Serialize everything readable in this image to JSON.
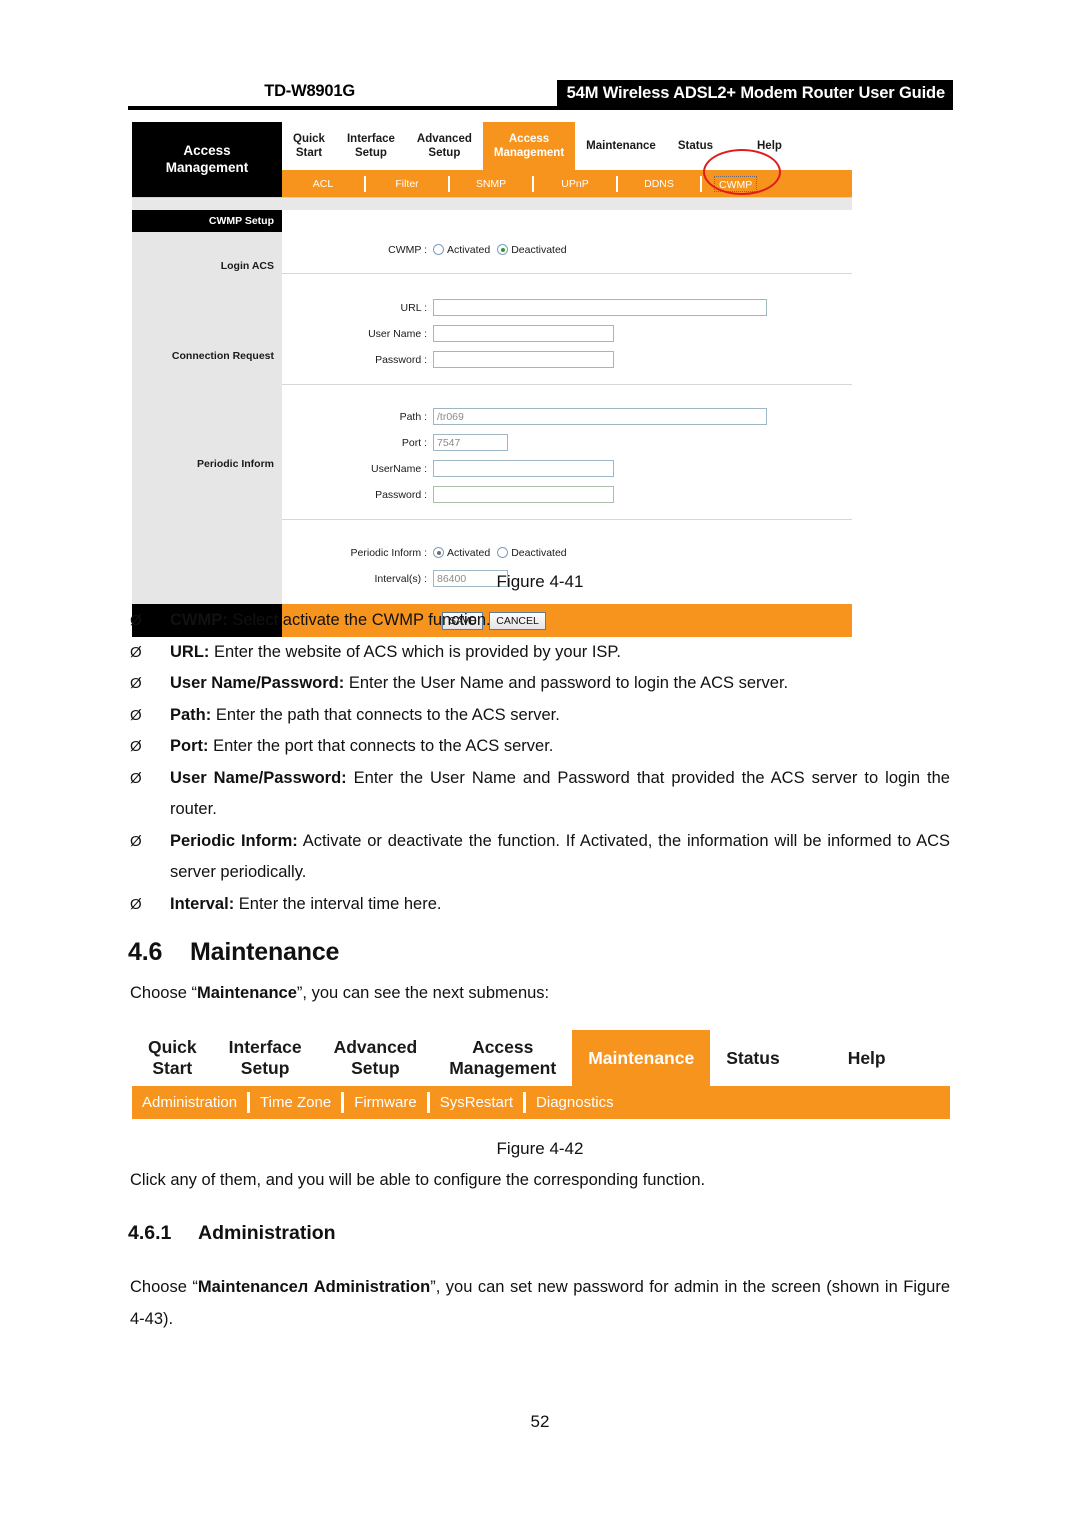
{
  "header": {
    "model": "TD-W8901G",
    "title": "54M Wireless ADSL2+ Modem Router User Guide"
  },
  "figure41": {
    "brand_line1": "Access",
    "brand_line2": "Management",
    "main_nav": [
      {
        "line1": "Quick",
        "line2": "Start",
        "active": false
      },
      {
        "line1": "Interface",
        "line2": "Setup",
        "active": false
      },
      {
        "line1": "Advanced",
        "line2": "Setup",
        "active": false
      },
      {
        "line1": "Access",
        "line2": "Management",
        "active": true
      },
      {
        "line1": "Maintenance",
        "line2": "",
        "active": false
      },
      {
        "line1": "Status",
        "line2": "",
        "active": false
      },
      {
        "line1": "Help",
        "line2": "",
        "active": false
      }
    ],
    "sub_nav": [
      "ACL",
      "Filter",
      "SNMP",
      "UPnP",
      "DDNS"
    ],
    "sub_nav_focused": "CWMP",
    "sidebar": {
      "title": "CWMP Setup",
      "login_acs": "Login ACS",
      "connection_request": "Connection Request",
      "periodic_inform": "Periodic Inform"
    },
    "fields": {
      "cwmp_label": "CWMP :",
      "cwmp_activated": "Activated",
      "cwmp_deactivated": "Deactivated",
      "cwmp_selected": "Deactivated",
      "url_label": "URL :",
      "url_value": "",
      "username_label": "User Name :",
      "username_value": "",
      "password_label": "Password :",
      "password_value": "",
      "path_label": "Path :",
      "path_value": "/tr069",
      "port_label": "Port :",
      "port_value": "7547",
      "cr_username_label": "UserName :",
      "cr_username_value": "",
      "cr_password_label": "Password :",
      "cr_password_value": "",
      "pi_label": "Periodic Inform :",
      "pi_activated": "Activated",
      "pi_deactivated": "Deactivated",
      "pi_selected": "Activated",
      "interval_label": "Interval(s) :",
      "interval_value": "86400"
    },
    "buttons": {
      "save": "SAVE",
      "cancel": "CANCEL"
    },
    "caption": "Figure 4-41"
  },
  "bullets41": [
    {
      "mark": "Ø",
      "term": "CWMP:",
      "text": " Select activate the CWMP function."
    },
    {
      "mark": "Ø",
      "term": "URL:",
      "text": " Enter the website of ACS which is provided by your ISP."
    },
    {
      "mark": "Ø",
      "term": "User Name/Password:",
      "text": " Enter the User Name and password to login the ACS server."
    },
    {
      "mark": "Ø",
      "term": "Path:",
      "text": " Enter the path that connects to the ACS server."
    },
    {
      "mark": "Ø",
      "term": "Port:",
      "text": " Enter the port that connects to the ACS server."
    },
    {
      "mark": "Ø",
      "term": "User Name/Password:",
      "text": " Enter the User Name and Password that provided the ACS server to login the router."
    },
    {
      "mark": "Ø",
      "term": "Periodic Inform:",
      "text": " Activate or deactivate the function. If Activated, the information will be informed to ACS server periodically."
    },
    {
      "mark": "Ø",
      "term": "Interval:",
      "text": " Enter the interval time here."
    }
  ],
  "section": {
    "number": "4.6",
    "title": "Maintenance",
    "intro_pre": "Choose “",
    "intro_bold": "Maintenance",
    "intro_post": "”, you can see the next submenus:"
  },
  "figure42": {
    "main_nav": [
      {
        "line1": "Quick",
        "line2": "Start",
        "active": false
      },
      {
        "line1": "Interface",
        "line2": "Setup",
        "active": false
      },
      {
        "line1": "Advanced",
        "line2": "Setup",
        "active": false
      },
      {
        "line1": "Access",
        "line2": "Management",
        "active": false
      },
      {
        "line1": "Maintenance",
        "line2": "",
        "active": true
      },
      {
        "line1": "Status",
        "line2": "",
        "active": false
      },
      {
        "line1": "Help",
        "line2": "",
        "active": false
      }
    ],
    "sub_nav": [
      "Administration",
      "Time Zone",
      "Firmware",
      "SysRestart",
      "Diagnostics"
    ],
    "caption": "Figure 4-42"
  },
  "after42": "Click any of them, and you will be able to configure the corresponding function.",
  "subsection": {
    "number": "4.6.1",
    "title": "Administration",
    "body_pre": "Choose “",
    "body_bold": "Maintenanceл Administration",
    "body_post": "”, you can set new password for admin in the screen (shown in Figure 4-43)."
  },
  "page_number": "52",
  "colors": {
    "accent_orange": "#f7941e",
    "annotation_red": "#e01b1b",
    "sidebar_grey": "#e6e6e6"
  }
}
